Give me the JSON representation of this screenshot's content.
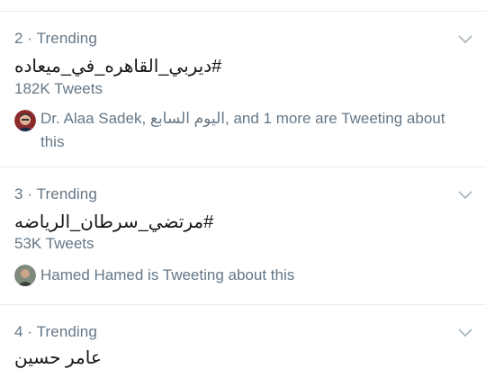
{
  "trends": [
    {
      "meta": "2 · Trending",
      "name": "#ديربي_القاهره_في_ميعاده",
      "count": "182K Tweets",
      "context_line1": "Dr. Alaa Sadek, اليوم السابع, and 1 more are Tweeting about",
      "context_line2": "this"
    },
    {
      "meta": "3 · Trending",
      "name": "#مرتضي_سرطان_الرياضه",
      "count": "53K Tweets",
      "context_line1": "Hamed Hamed is Tweeting about this"
    },
    {
      "meta": "4 · Trending",
      "name": "عامر حسين"
    }
  ],
  "icons": {
    "chevron": "chevron-down-icon",
    "avatar1": "avatar-dr-alaa-sadek",
    "avatar2": "avatar-hamed-hamed"
  },
  "colors": {
    "secondary_text": "#657786",
    "primary_text": "#14171a",
    "divider": "#e6ecf0",
    "chevron": "#aab8c2"
  }
}
